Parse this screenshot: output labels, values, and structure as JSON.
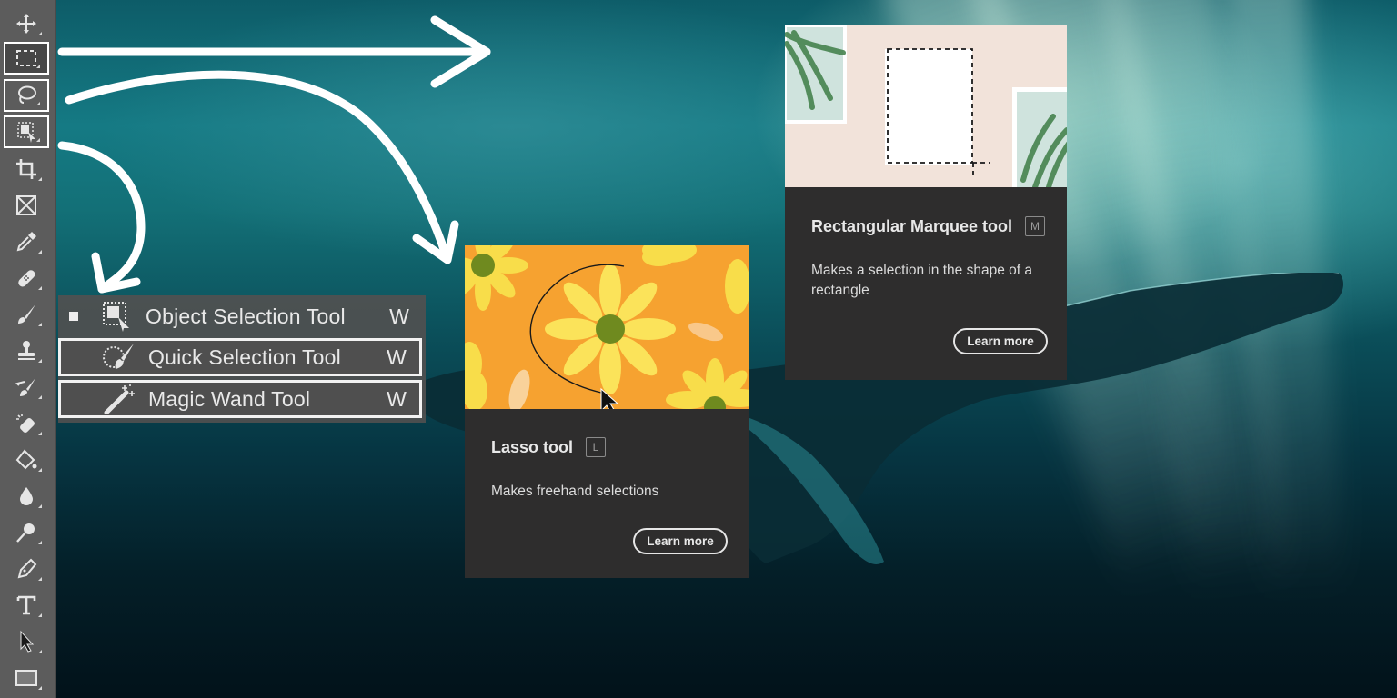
{
  "toolbar": {
    "tools": [
      {
        "name": "move-tool",
        "icon": "move-icon",
        "highlighted": false
      },
      {
        "name": "rectangular-marquee-tool",
        "icon": "rectangular-marquee-icon",
        "highlighted": true,
        "active": true
      },
      {
        "name": "lasso-tool",
        "icon": "lasso-icon",
        "highlighted": true
      },
      {
        "name": "object-selection-tool",
        "icon": "object-selection-icon",
        "highlighted": true
      },
      {
        "name": "crop-tool",
        "icon": "crop-icon",
        "highlighted": false
      },
      {
        "name": "frame-tool",
        "icon": "frame-icon",
        "highlighted": false
      },
      {
        "name": "eyedropper-tool",
        "icon": "eyedropper-icon",
        "highlighted": false
      },
      {
        "name": "spot-healing-tool",
        "icon": "bandage-icon",
        "highlighted": false
      },
      {
        "name": "brush-tool",
        "icon": "brush-icon",
        "highlighted": false
      },
      {
        "name": "clone-stamp-tool",
        "icon": "stamp-icon",
        "highlighted": false
      },
      {
        "name": "history-brush-tool",
        "icon": "history-brush-icon",
        "highlighted": false
      },
      {
        "name": "eraser-tool",
        "icon": "eraser-icon",
        "highlighted": false
      },
      {
        "name": "paint-bucket-tool",
        "icon": "paint-bucket-icon",
        "highlighted": false
      },
      {
        "name": "blur-tool",
        "icon": "drop-icon",
        "highlighted": false
      },
      {
        "name": "dodge-tool",
        "icon": "dodge-icon",
        "highlighted": false
      },
      {
        "name": "pen-tool",
        "icon": "pen-icon",
        "highlighted": false
      },
      {
        "name": "type-tool",
        "icon": "type-icon",
        "highlighted": false
      },
      {
        "name": "path-selection-tool",
        "icon": "arrow-cursor-icon",
        "highlighted": false
      },
      {
        "name": "rectangle-tool",
        "icon": "rectangle-icon",
        "highlighted": false
      }
    ]
  },
  "flyout": {
    "items": [
      {
        "label": "Object Selection Tool",
        "shortcut": "W",
        "selected": true,
        "icon": "object-selection-icon"
      },
      {
        "label": "Quick Selection Tool",
        "shortcut": "W",
        "selected": false,
        "icon": "quick-selection-icon"
      },
      {
        "label": "Magic Wand Tool",
        "shortcut": "W",
        "selected": false,
        "icon": "magic-wand-icon"
      }
    ]
  },
  "cards": {
    "marquee": {
      "title": "Rectangular Marquee tool",
      "shortcut": "M",
      "description": "Makes a selection in the shape of a rectangle",
      "button": "Learn more"
    },
    "lasso": {
      "title": "Lasso tool",
      "shortcut": "L",
      "description": "Makes freehand selections",
      "button": "Learn more"
    }
  },
  "colors": {
    "toolbar_bg": "#5c5c5c",
    "card_bg": "#2e2d2d",
    "lasso_thumb": "#f6a230",
    "marquee_thumb": "#f2e3da",
    "annotation": "#ffffff"
  }
}
